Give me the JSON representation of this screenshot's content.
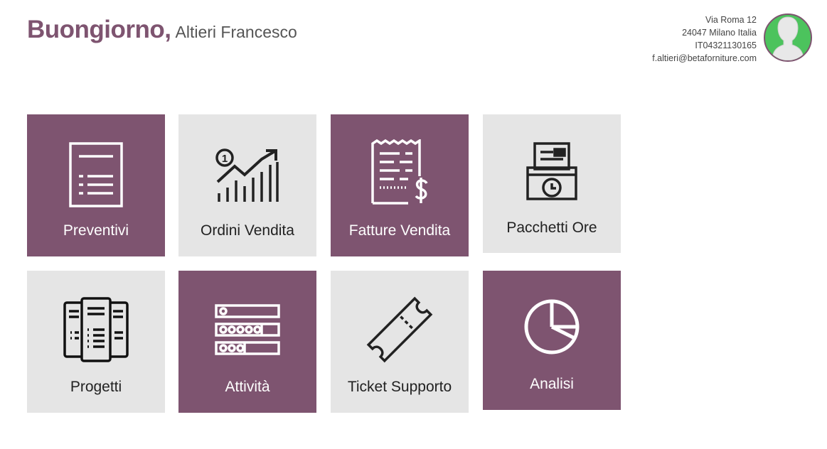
{
  "header": {
    "greeting": "Buongiorno,",
    "user_name": "Altieri Francesco"
  },
  "company": {
    "address": "Via Roma 12",
    "city": "24047 Milano Italia",
    "vat": "IT04321130165",
    "email": "f.altieri@betaforniture.com"
  },
  "avatar": {
    "icon": "user-avatar-icon",
    "background_color": "#4cc35d",
    "border_color": "#7e5470"
  },
  "theme": {
    "primary": "#7e5470",
    "tile_grey": "#e5e5e5"
  },
  "tiles": [
    {
      "label": "Preventivi",
      "icon": "document-list-icon",
      "style": "purple"
    },
    {
      "label": "Ordini Vendita",
      "icon": "growth-chart-icon",
      "style": "grey"
    },
    {
      "label": "Fatture Vendita",
      "icon": "invoice-dollar-icon",
      "style": "purple"
    },
    {
      "label": "Pacchetti Ore",
      "icon": "time-card-printer-icon",
      "style": "grey"
    },
    {
      "label": "Progetti",
      "icon": "project-sheets-icon",
      "style": "grey"
    },
    {
      "label": "Attività",
      "icon": "activity-list-icon",
      "style": "purple"
    },
    {
      "label": "Ticket Supporto",
      "icon": "ticket-icon",
      "style": "grey"
    },
    {
      "label": "Analisi",
      "icon": "pie-chart-icon",
      "style": "purple"
    }
  ]
}
